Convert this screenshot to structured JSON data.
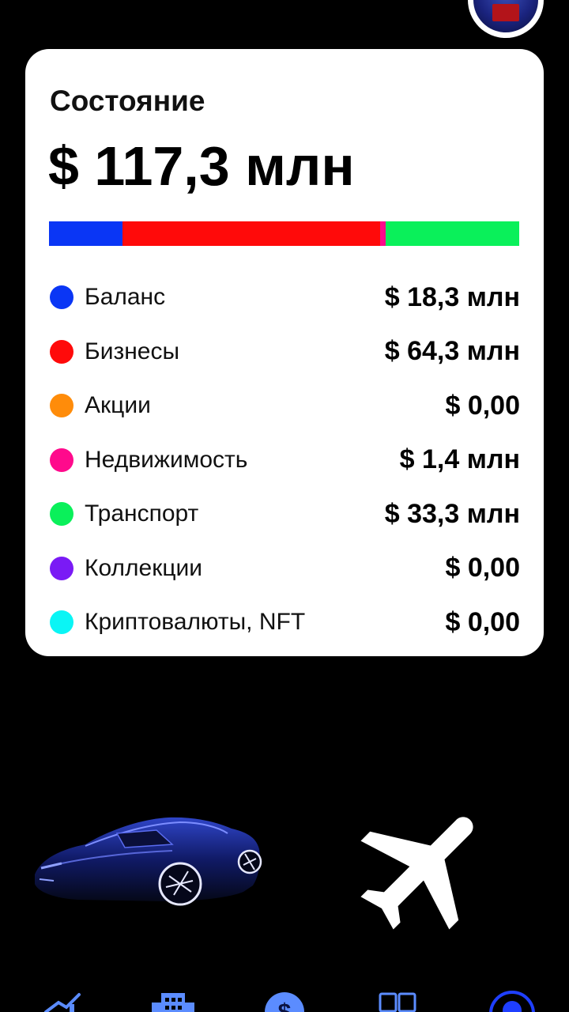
{
  "header": {
    "avatar_icon": "user-avatar-icon"
  },
  "net_worth": {
    "title": "Состояние",
    "total": "$ 117,3 млн",
    "breakdown": [
      {
        "label": "Баланс",
        "value": "$ 18,3 млн",
        "amount": 18.3,
        "color": "#0A36F5"
      },
      {
        "label": "Бизнесы",
        "value": "$ 64,3 млн",
        "amount": 64.3,
        "color": "#FF0A0A"
      },
      {
        "label": "Акции",
        "value": "$ 0,00",
        "amount": 0,
        "color": "#FF8C0A"
      },
      {
        "label": "Недвижимость",
        "value": "$ 1,4 млн",
        "amount": 1.4,
        "color": "#FF0A8C"
      },
      {
        "label": "Транспорт",
        "value": "$ 33,3 млн",
        "amount": 33.3,
        "color": "#0AF05A"
      },
      {
        "label": "Коллекции",
        "value": "$ 0,00",
        "amount": 0,
        "color": "#7A1AF5"
      },
      {
        "label": "Криптовалюты, NFT",
        "value": "$ 0,00",
        "amount": 0,
        "color": "#0AF5F5"
      }
    ]
  },
  "assets": {
    "car_icon": "sports-car-icon",
    "plane_icon": "airplane-icon"
  },
  "bottom_nav": [
    {
      "icon": "chart-growth-icon"
    },
    {
      "icon": "business-building-icon"
    },
    {
      "icon": "dollar-icon"
    },
    {
      "icon": "cards-icon"
    },
    {
      "icon": "profile-icon"
    }
  ]
}
